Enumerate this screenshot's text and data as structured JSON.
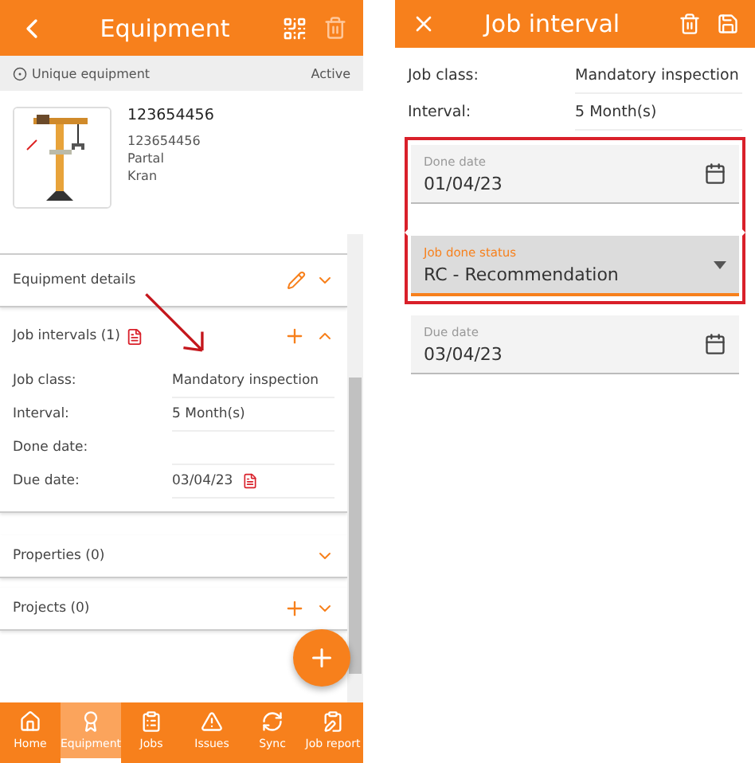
{
  "equipment_screen": {
    "title": "Equipment",
    "subheader": {
      "label": "Unique equipment",
      "status": "Active"
    },
    "equipment": {
      "number": "123654456",
      "details": [
        "123654456",
        "Partal",
        "Kran"
      ]
    },
    "sections": [
      {
        "kind": "details",
        "title": "Equipment details",
        "expanded": false
      },
      {
        "kind": "intervals",
        "title": "Job intervals (1)",
        "expanded": true,
        "rows": [
          {
            "label": "Job class:",
            "value": "Mandatory inspection"
          },
          {
            "label": "Interval:",
            "value": "5 Month(s)"
          },
          {
            "label": "Done date:",
            "value": ""
          },
          {
            "label": "Due date:",
            "value": "03/04/23",
            "doc": true
          }
        ]
      },
      {
        "kind": "plain",
        "title": "Properties (0)",
        "expanded": false
      },
      {
        "kind": "add",
        "title": "Projects (0)",
        "expanded": false
      }
    ],
    "nav": [
      {
        "kind": "home",
        "label": "Home",
        "selected": false
      },
      {
        "kind": "equipment",
        "label": "Equipment",
        "selected": true
      },
      {
        "kind": "jobs",
        "label": "Jobs",
        "selected": false
      },
      {
        "kind": "issues",
        "label": "Issues",
        "selected": false
      },
      {
        "kind": "sync",
        "label": "Sync",
        "selected": false
      },
      {
        "kind": "report",
        "label": "Job report",
        "selected": false
      }
    ]
  },
  "job_interval_screen": {
    "title": "Job interval",
    "rows": [
      {
        "label": "Job class:",
        "value": "Mandatory inspection"
      },
      {
        "label": "Interval:",
        "value": "5 Month(s)"
      }
    ],
    "fields": [
      {
        "kind": "date",
        "label": "Done date",
        "value": "01/04/23",
        "highlighted": true,
        "focused": false
      },
      {
        "kind": "select",
        "label": "Job done status",
        "value": "RC - Recommendation",
        "highlighted": true,
        "focused": true
      },
      {
        "kind": "date",
        "label": "Due date",
        "value": "03/04/23",
        "highlighted": false,
        "focused": false
      }
    ]
  }
}
